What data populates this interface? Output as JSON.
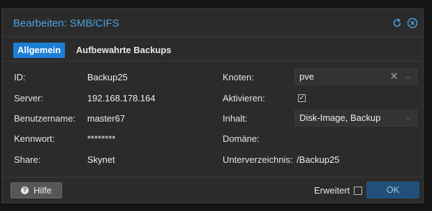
{
  "window": {
    "title": "Bearbeiten: SMB/CIFS"
  },
  "tabs": [
    {
      "label": "Allgemein",
      "active": true
    },
    {
      "label": "Aufbewahrte Backups",
      "active": false
    }
  ],
  "form": {
    "id": {
      "label": "ID:",
      "value": "Backup25"
    },
    "server": {
      "label": "Server:",
      "value": "192.168.178.164"
    },
    "username": {
      "label": "Benutzername:",
      "value": "master67"
    },
    "password": {
      "label": "Kennwort:",
      "value": "********"
    },
    "share": {
      "label": "Share:",
      "value": "Skynet"
    },
    "nodes": {
      "label": "Knoten:",
      "value": "pve"
    },
    "enable": {
      "label": "Aktivieren:",
      "checked": true
    },
    "content": {
      "label": "Inhalt:",
      "value": "Disk-Image, Backup"
    },
    "domain": {
      "label": "Domäne:",
      "value": ""
    },
    "subdir": {
      "label": "Unterverzeichnis:",
      "value": "/Backup25"
    }
  },
  "footer": {
    "help_label": "Hilfe",
    "advanced_label": "Erweitert",
    "advanced_checked": false,
    "ok_label": "OK"
  },
  "colors": {
    "accent": "#4aa3df",
    "tab_active": "#1c7fd6",
    "ok_button": "#1f4f7a"
  }
}
